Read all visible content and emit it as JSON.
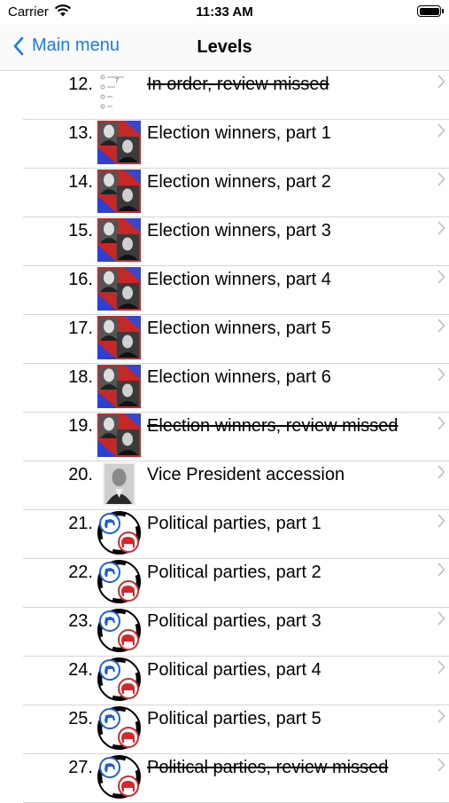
{
  "status": {
    "carrier": "Carrier",
    "time": "11:33 AM"
  },
  "nav": {
    "back_label": "Main menu",
    "title": "Levels"
  },
  "levels": [
    {
      "num": "12.",
      "label": "In order, review missed",
      "icon": "order-list-thumb",
      "struck": true
    },
    {
      "num": "13.",
      "label": "Election winners, part 1",
      "icon": "presidents-portrait-thumb",
      "struck": false
    },
    {
      "num": "14.",
      "label": "Election winners, part 2",
      "icon": "presidents-portrait-thumb",
      "struck": false
    },
    {
      "num": "15.",
      "label": "Election winners, part 3",
      "icon": "presidents-portrait-thumb",
      "struck": false
    },
    {
      "num": "16.",
      "label": "Election winners, part 4",
      "icon": "presidents-portrait-thumb",
      "struck": false
    },
    {
      "num": "17.",
      "label": "Election winners, part 5",
      "icon": "presidents-portrait-thumb",
      "struck": false
    },
    {
      "num": "18.",
      "label": "Election winners, part 6",
      "icon": "presidents-portrait-thumb",
      "struck": false
    },
    {
      "num": "19.",
      "label": "Election winners, review missed",
      "icon": "presidents-portrait-thumb",
      "struck": true
    },
    {
      "num": "20.",
      "label": "Vice President accession",
      "icon": "vice-president-portrait-thumb",
      "struck": false
    },
    {
      "num": "21.",
      "label": "Political parties, part 1",
      "icon": "party-symbols-thumb",
      "struck": false
    },
    {
      "num": "22.",
      "label": "Political parties, part 2",
      "icon": "party-symbols-thumb",
      "struck": false
    },
    {
      "num": "23.",
      "label": "Political parties, part 3",
      "icon": "party-symbols-thumb",
      "struck": false
    },
    {
      "num": "24.",
      "label": "Political parties, part 4",
      "icon": "party-symbols-thumb",
      "struck": false
    },
    {
      "num": "25.",
      "label": "Political parties, part 5",
      "icon": "party-symbols-thumb",
      "struck": false
    },
    {
      "num": "27.",
      "label": "Political parties, review missed",
      "icon": "party-symbols-thumb",
      "struck": true
    }
  ],
  "colors": {
    "accent": "#1d7aef",
    "separator": "#d6d6d6",
    "democrat": "#1f5fd6",
    "republican": "#d62828"
  }
}
